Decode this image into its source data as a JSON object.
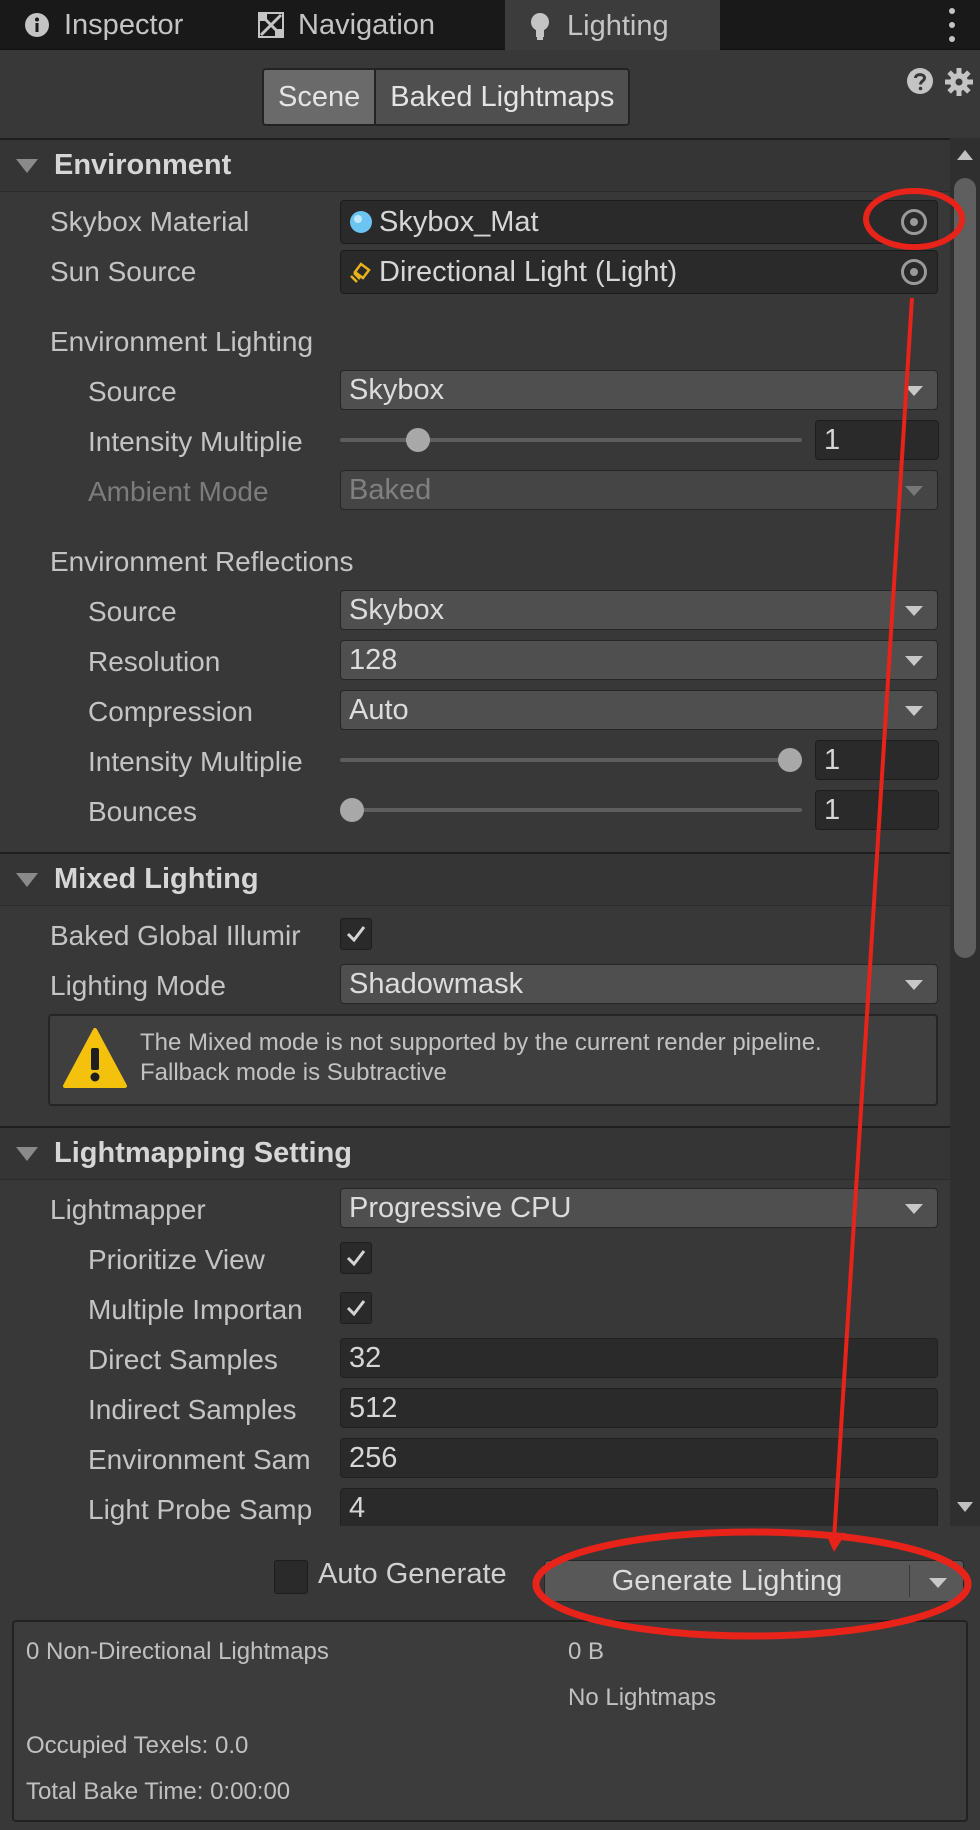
{
  "tabs": [
    {
      "label": "Inspector",
      "icon": "info-icon"
    },
    {
      "label": "Navigation",
      "icon": "navigation-icon"
    },
    {
      "label": "Lighting",
      "icon": "lightbulb-icon"
    }
  ],
  "toolbar": {
    "segments": [
      "Scene",
      "Baked Lightmaps"
    ],
    "active_segment": "Scene"
  },
  "sections": {
    "environment": {
      "title": "Environment",
      "skybox_material": {
        "label": "Skybox Material",
        "value": "Skybox_Mat"
      },
      "sun_source": {
        "label": "Sun Source",
        "value": "Directional Light (Light)"
      },
      "env_lighting": {
        "title": "Environment Lighting",
        "source": {
          "label": "Source",
          "value": "Skybox"
        },
        "intensity": {
          "label": "Intensity Multiplie",
          "value": "1",
          "slider_fraction": 0.15
        },
        "ambient_mode": {
          "label": "Ambient Mode",
          "value": "Baked"
        }
      },
      "env_reflections": {
        "title": "Environment Reflections",
        "source": {
          "label": "Source",
          "value": "Skybox"
        },
        "resolution": {
          "label": "Resolution",
          "value": "128"
        },
        "compression": {
          "label": "Compression",
          "value": "Auto"
        },
        "intensity": {
          "label": "Intensity Multiplie",
          "value": "1",
          "slider_fraction": 1.0
        },
        "bounces": {
          "label": "Bounces",
          "value": "1",
          "slider_fraction": 0.0
        }
      }
    },
    "mixed": {
      "title": "Mixed Lighting",
      "baked_gi": {
        "label": "Baked Global Illumir",
        "checked": true
      },
      "lighting_mode": {
        "label": "Lighting Mode",
        "value": "Shadowmask"
      },
      "warning_line1": "The Mixed mode is not supported by the current render pipeline.",
      "warning_line2": "Fallback mode is Subtractive"
    },
    "lightmapping": {
      "title": "Lightmapping Setting",
      "lightmapper": {
        "label": "Lightmapper",
        "value": "Progressive CPU"
      },
      "prioritize_view": {
        "label": "Prioritize View",
        "checked": true
      },
      "multiple_importance": {
        "label": "Multiple Importan",
        "checked": true
      },
      "direct_samples": {
        "label": "Direct Samples",
        "value": "32"
      },
      "indirect_samples": {
        "label": "Indirect Samples",
        "value": "512"
      },
      "environment_samples": {
        "label": "Environment Sam",
        "value": "256"
      },
      "light_probe_samples": {
        "label": "Light Probe Samp",
        "value": "4"
      }
    }
  },
  "bottom": {
    "auto_generate": {
      "label": "Auto Generate",
      "checked": false
    },
    "generate_button": "Generate Lighting",
    "stats": {
      "lightmaps": "0 Non-Directional Lightmaps",
      "size": "0 B",
      "no_lightmaps": "No Lightmaps",
      "occupied": "Occupied Texels: 0.0",
      "bake_time": "Total Bake Time: 0:00:00"
    }
  },
  "colors": {
    "annotation_red": "#e8231a",
    "warning_yellow": "#f4c20d",
    "skybox_blue": "#6cc4f2"
  }
}
